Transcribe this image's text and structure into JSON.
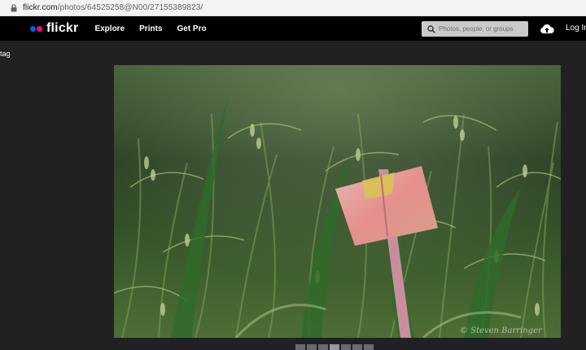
{
  "browser": {
    "url_host": "flickr.com",
    "url_path": "/photos/64525258@N00/27155389823/"
  },
  "header": {
    "logo_text": "flickr",
    "nav": [
      {
        "label": "Explore"
      },
      {
        "label": "Prints"
      },
      {
        "label": "Get Pro"
      }
    ],
    "search_placeholder": "Photos, people, or groups",
    "login_label": "Log In"
  },
  "sidebar": {
    "tag_text": "tag"
  },
  "photo": {
    "watermark": "© Steven Barringer",
    "thumbnails_count": 7,
    "active_thumbnail": 3
  },
  "colors": {
    "flickr_blue": "#0063dc",
    "flickr_pink": "#ff0084",
    "header_bg": "#000000",
    "page_bg": "#212124"
  }
}
